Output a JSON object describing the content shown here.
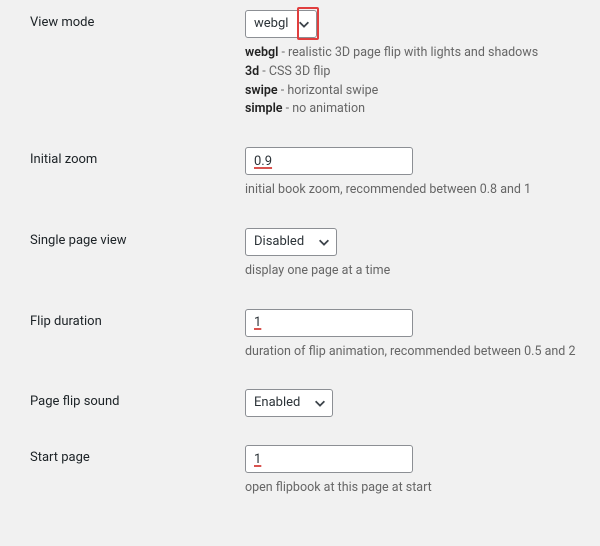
{
  "viewMode": {
    "label": "View mode",
    "value": "webgl",
    "descLines": [
      {
        "bold": "webgl",
        "text": " - realistic 3D page flip with lights and shadows"
      },
      {
        "bold": "3d",
        "text": " - CSS 3D flip"
      },
      {
        "bold": "swipe",
        "text": " - horizontal swipe"
      },
      {
        "bold": "simple",
        "text": " - no animation"
      }
    ]
  },
  "initialZoom": {
    "label": "Initial zoom",
    "value": "0.9",
    "desc": "initial book zoom, recommended between 0.8 and 1"
  },
  "singlePageView": {
    "label": "Single page view",
    "value": "Disabled",
    "desc": "display one page at a time"
  },
  "flipDuration": {
    "label": "Flip duration",
    "value": "1",
    "desc": "duration of flip animation, recommended between 0.5 and 2"
  },
  "pageFlipSound": {
    "label": "Page flip sound",
    "value": "Enabled"
  },
  "startPage": {
    "label": "Start page",
    "value": "1",
    "desc": "open flipbook at this page at start"
  }
}
